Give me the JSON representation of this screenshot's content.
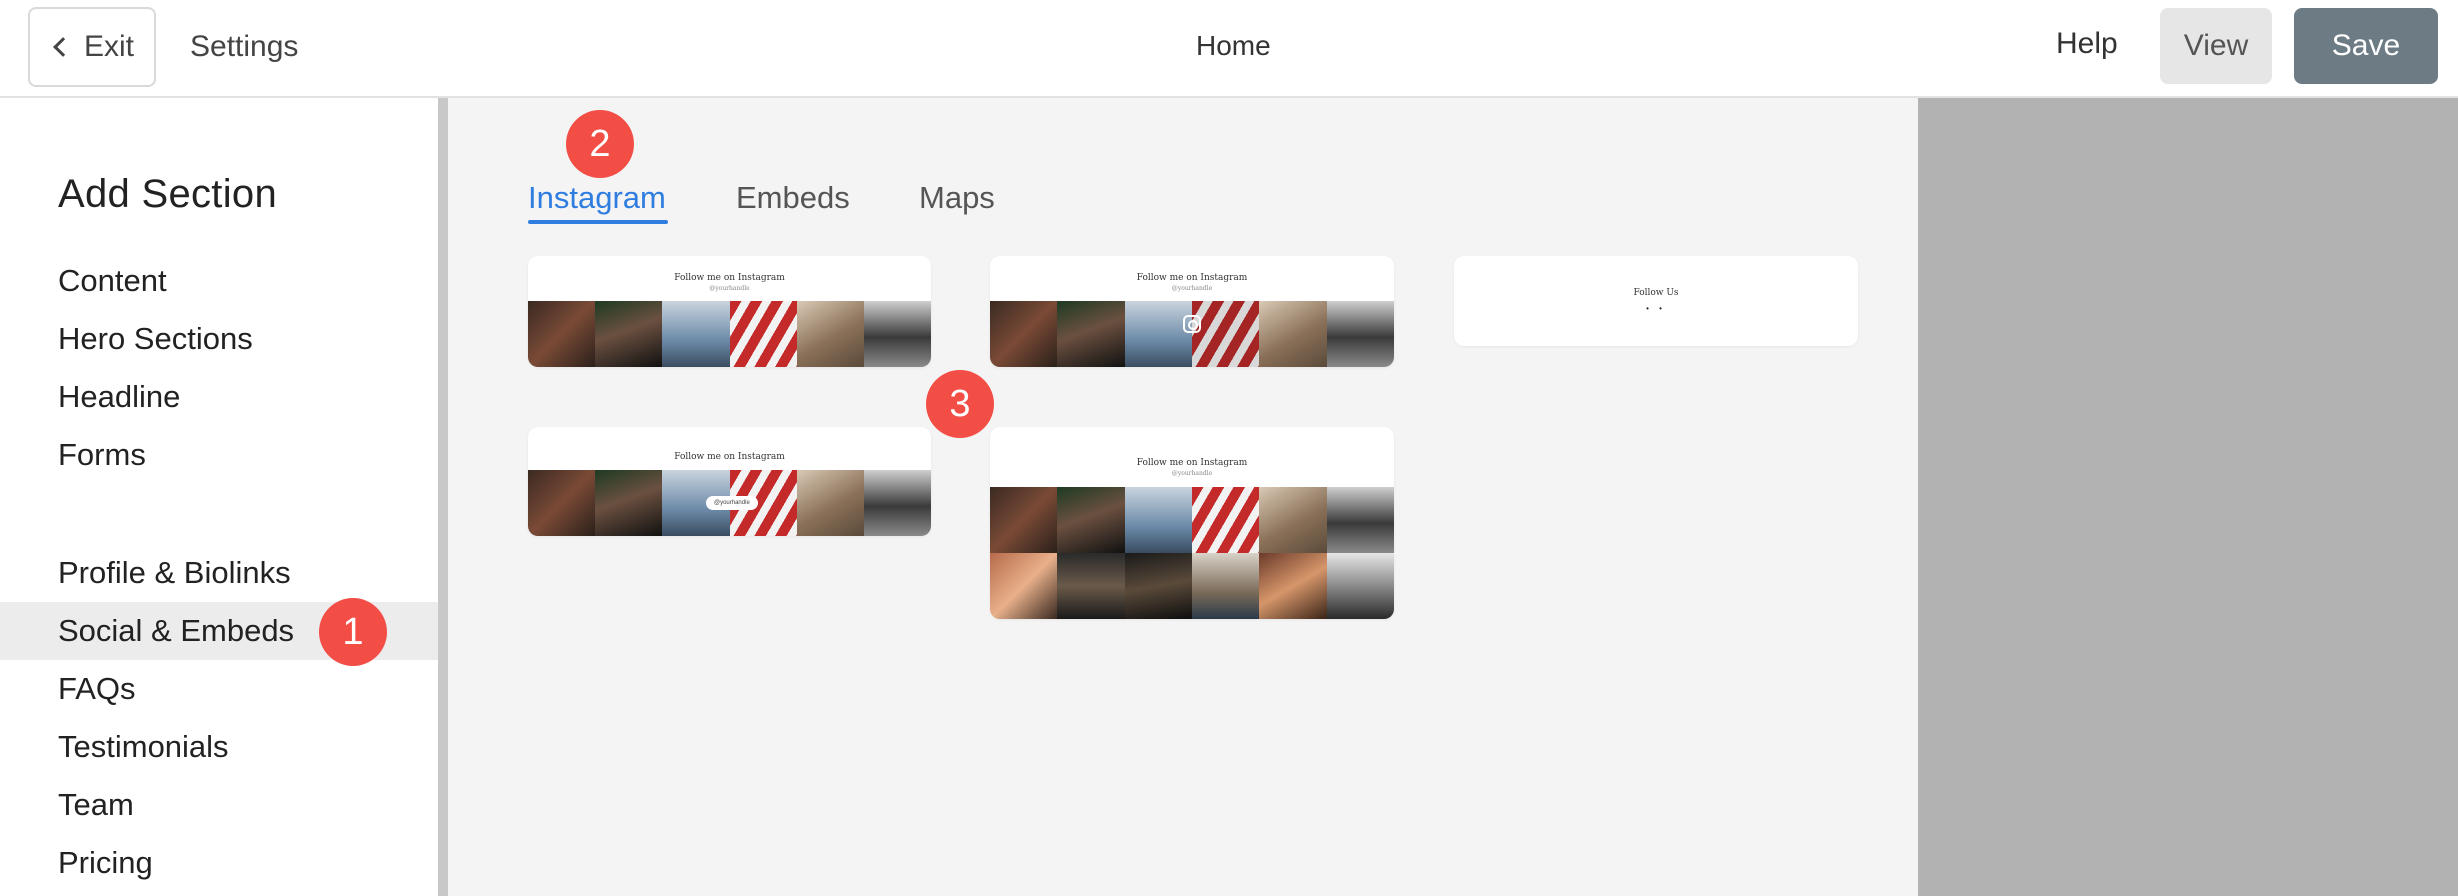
{
  "topbar": {
    "exit_label": "Exit",
    "settings_label": "Settings",
    "page_title": "Home",
    "help_label": "Help",
    "view_label": "View",
    "save_label": "Save"
  },
  "sidebar": {
    "heading": "Add Section",
    "items": [
      {
        "label": "Content"
      },
      {
        "label": "Hero Sections"
      },
      {
        "label": "Headline"
      },
      {
        "label": "Forms"
      },
      {
        "label": "Profile & Biolinks"
      },
      {
        "label": "Social & Embeds",
        "active": true
      },
      {
        "label": "FAQs"
      },
      {
        "label": "Testimonials"
      },
      {
        "label": "Team"
      },
      {
        "label": "Pricing"
      }
    ]
  },
  "tabs": [
    {
      "label": "Instagram",
      "active": true
    },
    {
      "label": "Embeds"
    },
    {
      "label": "Maps"
    }
  ],
  "cards": {
    "follow_title": "Follow me on Instagram",
    "handle": "@yourhandle",
    "follow_us_title": "Follow Us",
    "follow_us_icons": "• •"
  },
  "badges": {
    "step1": "1",
    "step2": "2",
    "step3": "3"
  },
  "colors": {
    "accent_blue": "#2f7de1",
    "badge_red": "#f24e45",
    "save_button": "#6d7b85",
    "preview_gray": "#b2b2b2",
    "panel_bg": "#f4f4f4"
  },
  "icons": {
    "exit": "chevron-left-icon",
    "instagram": "instagram-icon"
  }
}
